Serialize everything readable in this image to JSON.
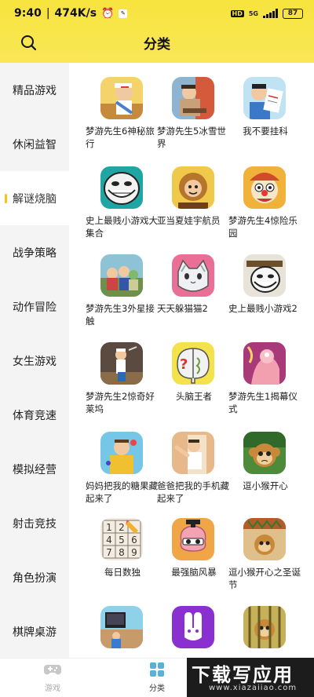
{
  "status_bar": {
    "time": "9:40",
    "speed": "474K/s",
    "network": "5G",
    "hd": "HD",
    "battery": "87"
  },
  "header": {
    "title": "分类"
  },
  "sidebar": {
    "items": [
      {
        "label": "精品游戏"
      },
      {
        "label": "休闲益智"
      },
      {
        "label": "解谜烧脑"
      },
      {
        "label": "战争策略"
      },
      {
        "label": "动作冒险"
      },
      {
        "label": "女生游戏"
      },
      {
        "label": "体育竞速"
      },
      {
        "label": "模拟经营"
      },
      {
        "label": "射击竞技"
      },
      {
        "label": "角色扮演"
      },
      {
        "label": "棋牌桌游"
      }
    ],
    "active_index": 2,
    "accent_color": "#f3c51a"
  },
  "games": [
    {
      "name": "梦游先生6神秘旅行",
      "icon": "mr-dream-6-icon"
    },
    {
      "name": "梦游先生5冰雪世界",
      "icon": "mr-dream-5-icon"
    },
    {
      "name": "我不要挂科",
      "icon": "no-fail-exam-icon"
    },
    {
      "name": "史上最贱小游戏大集合",
      "icon": "troll-face-icon"
    },
    {
      "name": "亚当夏娃宇航员",
      "icon": "adam-eve-icon"
    },
    {
      "name": "梦游先生4惊险乐园",
      "icon": "clown-icon"
    },
    {
      "name": "梦游先生3外星接触",
      "icon": "mr-dream-3-icon"
    },
    {
      "name": "天天躲猫猫2",
      "icon": "hide-cat-icon"
    },
    {
      "name": "史上最贱小游戏2",
      "icon": "troll-face-2-icon"
    },
    {
      "name": "梦游先生2惊奇好莱坞",
      "icon": "mr-dream-2-icon"
    },
    {
      "name": "头脑王者",
      "icon": "brain-icon"
    },
    {
      "name": "梦游先生1揭幕仪式",
      "icon": "mr-dream-1-icon"
    },
    {
      "name": "妈妈把我的糖果藏起来了",
      "icon": "candy-hidden-icon"
    },
    {
      "name": "爸爸把我的手机藏起来了",
      "icon": "phone-hidden-icon"
    },
    {
      "name": "逗小猴开心",
      "icon": "monkey-icon"
    },
    {
      "name": "每日数独",
      "icon": "sudoku-icon"
    },
    {
      "name": "最强脑风暴",
      "icon": "brainstorm-icon"
    },
    {
      "name": "逗小猴开心之圣诞节",
      "icon": "monkey-xmas-icon"
    },
    {
      "name": "",
      "icon": "tv-room-icon"
    },
    {
      "name": "",
      "icon": "rabbit-icon"
    },
    {
      "name": "",
      "icon": "monkey-cage-icon"
    }
  ],
  "sudoku_digits": [
    "1",
    "2",
    "",
    "4",
    "5",
    "6",
    "7",
    "8",
    "9"
  ],
  "tabbar": {
    "tabs": [
      {
        "label": "游戏"
      },
      {
        "label": "分类"
      }
    ]
  },
  "watermark": {
    "big": "下载写应用",
    "small": "www.xiazaiiao.com"
  }
}
